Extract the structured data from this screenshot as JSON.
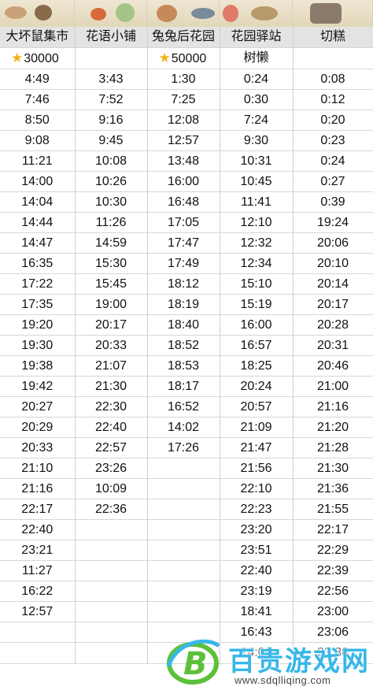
{
  "columns": [
    {
      "header": "大坏鼠集市",
      "prize": "30000",
      "prize_icon": "star-icon"
    },
    {
      "header": "花语小铺",
      "prize": "",
      "prize_icon": ""
    },
    {
      "header": "兔兔后花园",
      "prize": "50000",
      "prize_icon": "star-icon"
    },
    {
      "header": "花园驿站",
      "prize": "树懒",
      "prize_icon": ""
    },
    {
      "header": "切糕",
      "prize": "",
      "prize_icon": ""
    }
  ],
  "rows": [
    [
      "4:49",
      "3:43",
      "1:30",
      "0:24",
      "0:08"
    ],
    [
      "7:46",
      "7:52",
      "7:25",
      "0:30",
      "0:12"
    ],
    [
      "8:50",
      "9:16",
      "12:08",
      "7:24",
      "0:20"
    ],
    [
      "9:08",
      "9:45",
      "12:57",
      "9:30",
      "0:23"
    ],
    [
      "11:21",
      "10:08",
      "13:48",
      "10:31",
      "0:24"
    ],
    [
      "14:00",
      "10:26",
      "16:00",
      "10:45",
      "0:27"
    ],
    [
      "14:04",
      "10:30",
      "16:48",
      "11:41",
      "0:39"
    ],
    [
      "14:44",
      "11:26",
      "17:05",
      "12:10",
      "19:24"
    ],
    [
      "14:47",
      "14:59",
      "17:47",
      "12:32",
      "20:06"
    ],
    [
      "16:35",
      "15:30",
      "17:49",
      "12:34",
      "20:10"
    ],
    [
      "17:22",
      "15:45",
      "18:12",
      "15:10",
      "20:14"
    ],
    [
      "17:35",
      "19:00",
      "18:19",
      "15:19",
      "20:17"
    ],
    [
      "19:20",
      "20:17",
      "18:40",
      "16:00",
      "20:28"
    ],
    [
      "19:30",
      "20:33",
      "18:52",
      "16:57",
      "20:31"
    ],
    [
      "19:38",
      "21:07",
      "18:53",
      "18:25",
      "20:46"
    ],
    [
      "19:42",
      "21:30",
      "18:17",
      "20:24",
      "21:00"
    ],
    [
      "20:27",
      "22:30",
      "16:52",
      "20:57",
      "21:16"
    ],
    [
      "20:29",
      "22:40",
      "14:02",
      "21:09",
      "21:20"
    ],
    [
      "20:33",
      "22:57",
      "17:26",
      "21:47",
      "21:28"
    ],
    [
      "21:10",
      "23:26",
      "",
      "21:56",
      "21:30"
    ],
    [
      "21:16",
      "10:09",
      "",
      "22:10",
      "21:36"
    ],
    [
      "22:17",
      "22:36",
      "",
      "22:23",
      "21:55"
    ],
    [
      "22:40",
      "",
      "",
      "23:20",
      "22:17"
    ],
    [
      "23:21",
      "",
      "",
      "23:51",
      "22:29"
    ],
    [
      "11:27",
      "",
      "",
      "22:40",
      "22:39"
    ],
    [
      "16:22",
      "",
      "",
      "23:19",
      "22:56"
    ],
    [
      "12:57",
      "",
      "",
      "18:41",
      "23:00"
    ],
    [
      "",
      "",
      "",
      "16:43",
      "23:06"
    ]
  ],
  "partial_row": [
    "",
    "",
    "",
    "14:00",
    "23:30"
  ],
  "watermark": {
    "title": "百贵游戏网",
    "url": "www.sdqlliqing.com",
    "logo_letter": "B"
  },
  "colors": {
    "header_bg": "#e3e3e3",
    "star": "#f2b21b",
    "watermark_blue": "#38b7e8",
    "logo_green": "#5cc13a"
  }
}
